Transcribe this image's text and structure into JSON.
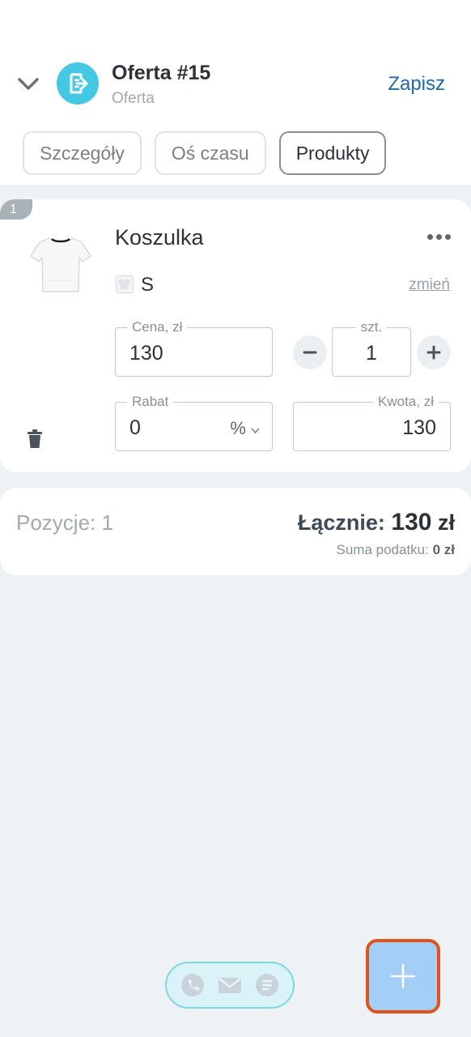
{
  "header": {
    "title": "Oferta #15",
    "subtitle": "Oferta",
    "save_label": "Zapisz",
    "accent_color": "#2067b0",
    "icon_color": "#45c8e3"
  },
  "tabs": [
    {
      "label": "Szczegóły",
      "active": false
    },
    {
      "label": "Oś czasu",
      "active": false
    },
    {
      "label": "Produkty",
      "active": true
    }
  ],
  "product": {
    "position": "1",
    "name": "Koszulka",
    "variant": "S",
    "change_label": "zmień",
    "price_label": "Cena, zł",
    "price_value": "130",
    "qty_label": "szt.",
    "qty_value": "1",
    "discount_label": "Rabat",
    "discount_value": "0",
    "discount_unit": "%",
    "amount_label": "Kwota, zł",
    "amount_value": "130"
  },
  "summary": {
    "positions": "Pozycje: 1",
    "total_label": "Łącznie:",
    "total_value": "130",
    "total_currency": "zł",
    "tax_label": "Suma podatku:",
    "tax_value": "0 zł"
  },
  "bottom": {
    "icons": [
      "phone-icon",
      "mail-icon",
      "chat-icon"
    ],
    "fab_icon": "plus-icon",
    "fab_highlight_color": "#e0521e"
  }
}
